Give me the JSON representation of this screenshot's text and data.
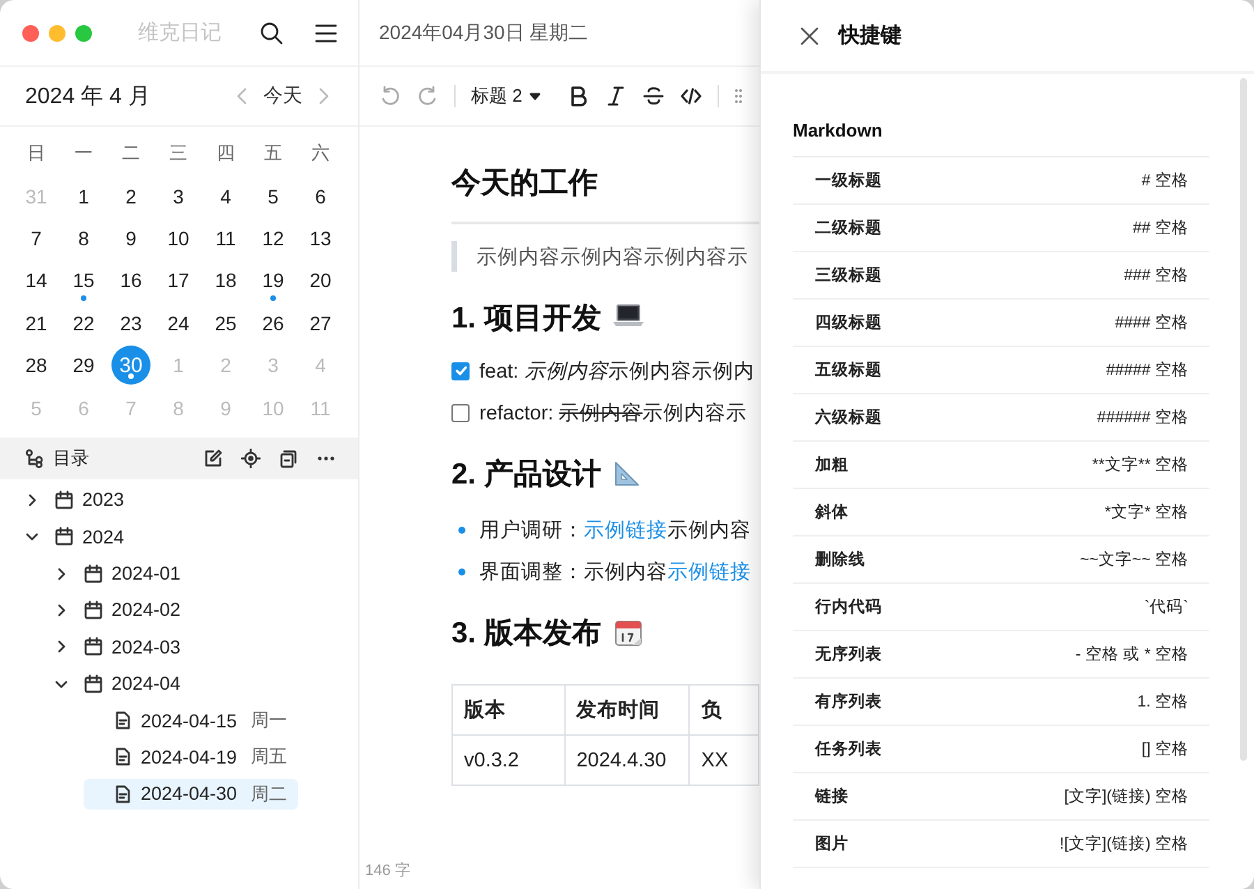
{
  "window": {
    "title": "维克日记"
  },
  "calendar": {
    "month_label": "2024 年 4 月",
    "today_button": "今天",
    "weekdays": [
      "日",
      "一",
      "二",
      "三",
      "四",
      "五",
      "六"
    ],
    "days": [
      {
        "day": "31",
        "in_month": false,
        "has_entry": false,
        "selected": false
      },
      {
        "day": "1",
        "in_month": true,
        "has_entry": false,
        "selected": false
      },
      {
        "day": "2",
        "in_month": true,
        "has_entry": false,
        "selected": false
      },
      {
        "day": "3",
        "in_month": true,
        "has_entry": false,
        "selected": false
      },
      {
        "day": "4",
        "in_month": true,
        "has_entry": false,
        "selected": false
      },
      {
        "day": "5",
        "in_month": true,
        "has_entry": false,
        "selected": false
      },
      {
        "day": "6",
        "in_month": true,
        "has_entry": false,
        "selected": false
      },
      {
        "day": "7",
        "in_month": true,
        "has_entry": false,
        "selected": false
      },
      {
        "day": "8",
        "in_month": true,
        "has_entry": false,
        "selected": false
      },
      {
        "day": "9",
        "in_month": true,
        "has_entry": false,
        "selected": false
      },
      {
        "day": "10",
        "in_month": true,
        "has_entry": false,
        "selected": false
      },
      {
        "day": "11",
        "in_month": true,
        "has_entry": false,
        "selected": false
      },
      {
        "day": "12",
        "in_month": true,
        "has_entry": false,
        "selected": false
      },
      {
        "day": "13",
        "in_month": true,
        "has_entry": false,
        "selected": false
      },
      {
        "day": "14",
        "in_month": true,
        "has_entry": false,
        "selected": false
      },
      {
        "day": "15",
        "in_month": true,
        "has_entry": true,
        "selected": false
      },
      {
        "day": "16",
        "in_month": true,
        "has_entry": false,
        "selected": false
      },
      {
        "day": "17",
        "in_month": true,
        "has_entry": false,
        "selected": false
      },
      {
        "day": "18",
        "in_month": true,
        "has_entry": false,
        "selected": false
      },
      {
        "day": "19",
        "in_month": true,
        "has_entry": true,
        "selected": false
      },
      {
        "day": "20",
        "in_month": true,
        "has_entry": false,
        "selected": false
      },
      {
        "day": "21",
        "in_month": true,
        "has_entry": false,
        "selected": false
      },
      {
        "day": "22",
        "in_month": true,
        "has_entry": false,
        "selected": false
      },
      {
        "day": "23",
        "in_month": true,
        "has_entry": false,
        "selected": false
      },
      {
        "day": "24",
        "in_month": true,
        "has_entry": false,
        "selected": false
      },
      {
        "day": "25",
        "in_month": true,
        "has_entry": false,
        "selected": false
      },
      {
        "day": "26",
        "in_month": true,
        "has_entry": false,
        "selected": false
      },
      {
        "day": "27",
        "in_month": true,
        "has_entry": false,
        "selected": false
      },
      {
        "day": "28",
        "in_month": true,
        "has_entry": false,
        "selected": false
      },
      {
        "day": "29",
        "in_month": true,
        "has_entry": false,
        "selected": false
      },
      {
        "day": "30",
        "in_month": true,
        "has_entry": true,
        "selected": true
      },
      {
        "day": "1",
        "in_month": false,
        "has_entry": false,
        "selected": false
      },
      {
        "day": "2",
        "in_month": false,
        "has_entry": false,
        "selected": false
      },
      {
        "day": "3",
        "in_month": false,
        "has_entry": false,
        "selected": false
      },
      {
        "day": "4",
        "in_month": false,
        "has_entry": false,
        "selected": false
      },
      {
        "day": "5",
        "in_month": false,
        "has_entry": false,
        "selected": false
      },
      {
        "day": "6",
        "in_month": false,
        "has_entry": false,
        "selected": false
      },
      {
        "day": "7",
        "in_month": false,
        "has_entry": false,
        "selected": false
      },
      {
        "day": "8",
        "in_month": false,
        "has_entry": false,
        "selected": false
      },
      {
        "day": "9",
        "in_month": false,
        "has_entry": false,
        "selected": false
      },
      {
        "day": "10",
        "in_month": false,
        "has_entry": false,
        "selected": false
      },
      {
        "day": "11",
        "in_month": false,
        "has_entry": false,
        "selected": false
      }
    ]
  },
  "outline": {
    "title": "目录",
    "tree": [
      {
        "label": "2023",
        "kind": "folder",
        "expanded": false
      },
      {
        "label": "2024",
        "kind": "folder",
        "expanded": true,
        "children": [
          {
            "label": "2024-01",
            "kind": "folder",
            "expanded": false
          },
          {
            "label": "2024-02",
            "kind": "folder",
            "expanded": false
          },
          {
            "label": "2024-03",
            "kind": "folder",
            "expanded": false
          },
          {
            "label": "2024-04",
            "kind": "folder",
            "expanded": true,
            "children": [
              {
                "label": "2024-04-15",
                "weekday": "周一",
                "kind": "doc",
                "selected": false
              },
              {
                "label": "2024-04-19",
                "weekday": "周五",
                "kind": "doc",
                "selected": false
              },
              {
                "label": "2024-04-30",
                "weekday": "周二",
                "kind": "doc",
                "selected": true
              }
            ]
          }
        ]
      }
    ]
  },
  "editor": {
    "date_title": "2024年04月30日 星期二",
    "heading_select": "标题 2",
    "word_count": "146 字",
    "blocks": [
      {
        "kind": "h1",
        "text": "今天的工作"
      },
      {
        "kind": "quote",
        "text": "示例内容示例内容示例内容示"
      },
      {
        "kind": "h2",
        "text": "1. 项目开发"
      },
      {
        "kind": "task",
        "checked": true,
        "segments": [
          {
            "kind": "plain",
            "text": "feat: "
          },
          {
            "kind": "italic",
            "text": "示例内容"
          },
          {
            "kind": "plain",
            "text": "示例内容示例内"
          }
        ]
      },
      {
        "kind": "task",
        "checked": false,
        "segments": [
          {
            "kind": "plain",
            "text": "refactor: "
          },
          {
            "kind": "strike",
            "text": "示例内容"
          },
          {
            "kind": "plain",
            "text": "示例内容示"
          }
        ]
      },
      {
        "kind": "h2",
        "text": "2. 产品设计"
      },
      {
        "kind": "bullet",
        "segments": [
          {
            "kind": "plain",
            "text": "用户调研："
          },
          {
            "kind": "link",
            "text": "示例链接"
          },
          {
            "kind": "plain",
            "text": "示例内容"
          }
        ]
      },
      {
        "kind": "bullet",
        "segments": [
          {
            "kind": "plain",
            "text": "界面调整：示例内容"
          },
          {
            "kind": "link",
            "text": "示例链接"
          }
        ]
      },
      {
        "kind": "h2",
        "text": "3. 版本发布"
      },
      {
        "kind": "table",
        "columns": [
          "版本",
          "发布时间",
          "负"
        ],
        "rows": [
          [
            "v0.3.2",
            "2024.4.30",
            "XX"
          ]
        ]
      }
    ]
  },
  "shortcuts": {
    "title": "快捷键",
    "section": "Markdown",
    "rows": [
      {
        "action": "一级标题",
        "keys": "# 空格"
      },
      {
        "action": "二级标题",
        "keys": "## 空格"
      },
      {
        "action": "三级标题",
        "keys": "### 空格"
      },
      {
        "action": "四级标题",
        "keys": "#### 空格"
      },
      {
        "action": "五级标题",
        "keys": "##### 空格"
      },
      {
        "action": "六级标题",
        "keys": "###### 空格"
      },
      {
        "action": "加粗",
        "keys": "**文字** 空格"
      },
      {
        "action": "斜体",
        "keys": "*文字* 空格"
      },
      {
        "action": "删除线",
        "keys": "~~文字~~ 空格"
      },
      {
        "action": "行内代码",
        "keys": "`代码`"
      },
      {
        "action": "无序列表",
        "keys": "- 空格 或 * 空格"
      },
      {
        "action": "有序列表",
        "keys": "1. 空格"
      },
      {
        "action": "任务列表",
        "keys": "[] 空格"
      },
      {
        "action": "链接",
        "keys": "[文字](链接) 空格"
      },
      {
        "action": "图片",
        "keys": "![文字](链接) 空格"
      }
    ]
  }
}
